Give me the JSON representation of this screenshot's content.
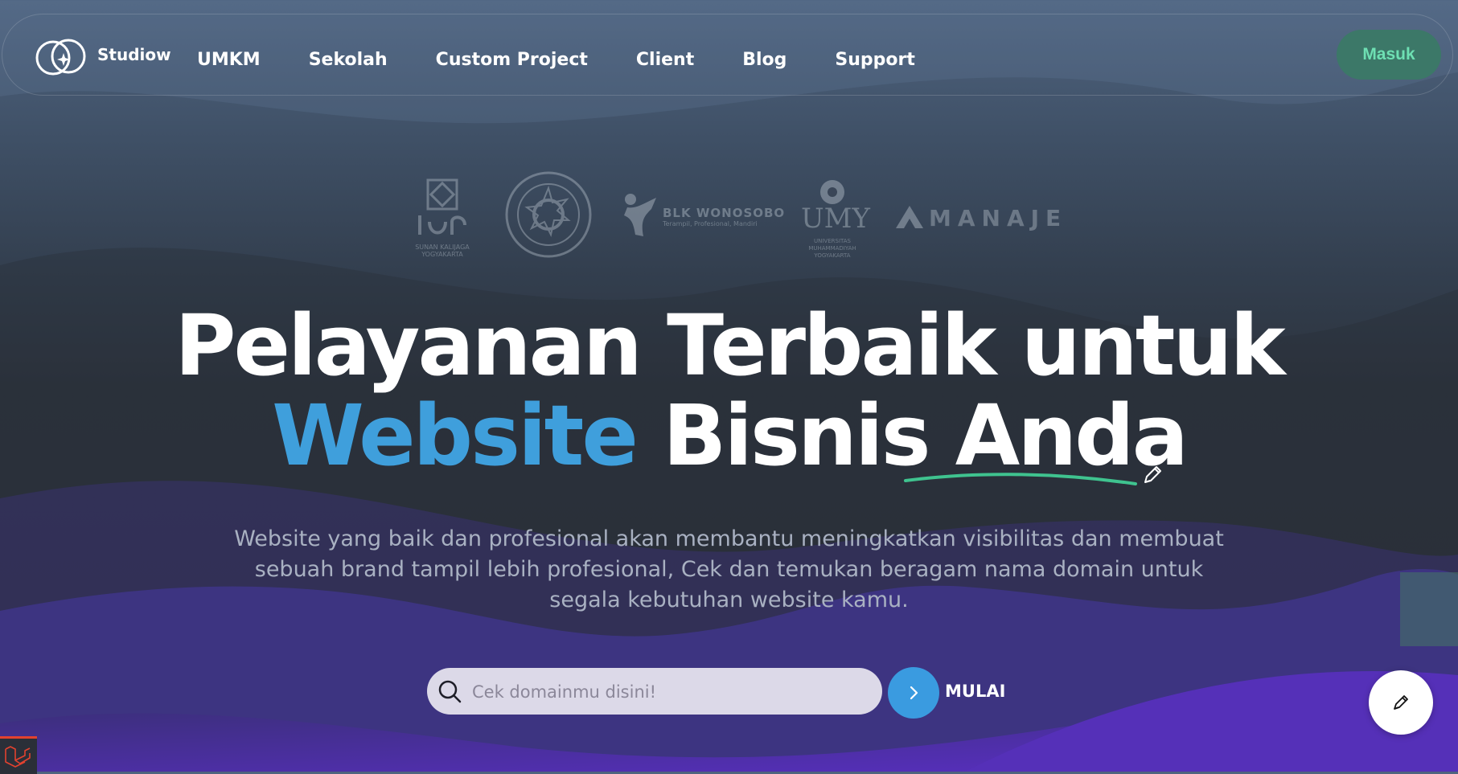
{
  "nav": {
    "brand": "Studiow",
    "links": [
      "UMKM",
      "Sekolah",
      "Custom Project",
      "Client",
      "Blog",
      "Support"
    ],
    "login_label": "Masuk"
  },
  "partners": {
    "uin_caption": "SUNAN KALIJAGA YOGYAKARTA",
    "blk_name": "BLK WONOSOBO",
    "blk_tagline": "Terampil, Profesional, Mandiri",
    "umy_name": "UMY",
    "umy_caption": "UNIVERSITAS MUHAMMADIYAH YOGYAKARTA",
    "manaje_name": "MANAJE"
  },
  "hero": {
    "title_line1": "Pelayanan Terbaik untuk",
    "title_highlight": "Website",
    "title_mid": "Bisnis",
    "title_end": "Anda",
    "subtitle": "Website yang baik dan profesional akan membantu meningkatkan visibilitas dan membuat sebuah brand tampil lebih profesional, Cek dan temukan beragam nama domain untuk segala kebutuhan website kamu."
  },
  "search": {
    "placeholder": "Cek domainmu disini!",
    "value": "",
    "submit_label": "MULAI"
  },
  "colors": {
    "accent_blue": "#3f9fdc",
    "accent_green": "#6ee0b3",
    "underline_green": "#3fc38f"
  }
}
